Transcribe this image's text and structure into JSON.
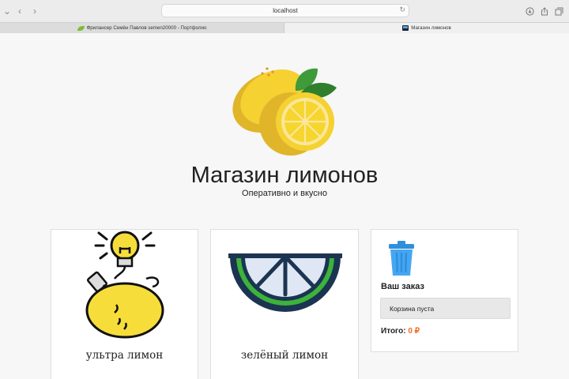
{
  "browser": {
    "address": "localhost",
    "tabs": [
      {
        "label": "Фрилансер Семён Павлов semen20000 - Портфолио"
      },
      {
        "label": "Магазин лимонов"
      }
    ]
  },
  "header": {
    "title": "Магазин лимонов",
    "subtitle": "Оперативно и вкусно"
  },
  "products": [
    {
      "name": "ультра лимон"
    },
    {
      "name": "зелёный лимон"
    }
  ],
  "order": {
    "title": "Ваш заказ",
    "cart_status": "Корзина пуста",
    "total_label": "Итого:",
    "total_value": "0 ₽"
  },
  "colors": {
    "accent": "#ef6a21",
    "lemon": "#f5d131",
    "leaf": "#3f9a3a",
    "trash": "#45a7f2"
  }
}
